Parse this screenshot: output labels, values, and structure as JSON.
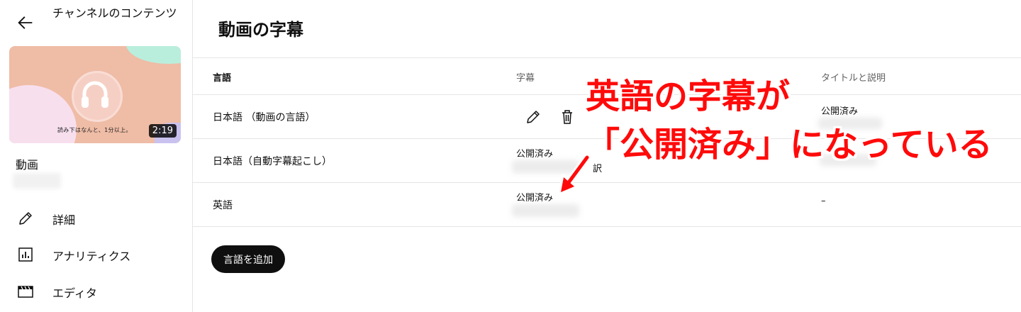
{
  "sidebar": {
    "channel_title": "チャンネルのコンテンツ",
    "thumbnail": {
      "caption": "読み下はなんと、1分以上。",
      "duration": "2:19"
    },
    "video_label": "動画",
    "nav": [
      {
        "label": "詳細",
        "icon": "pencil-icon"
      },
      {
        "label": "アナリティクス",
        "icon": "analytics-icon"
      },
      {
        "label": "エディタ",
        "icon": "clapperboard-icon"
      }
    ]
  },
  "main": {
    "title": "動画の字幕",
    "columns": {
      "language": "言語",
      "subtitles": "字幕",
      "title_desc": "タイトルと説明"
    },
    "rows": [
      {
        "language": "日本語 （動画の言語）",
        "subtitle_status": "",
        "title_status": "公開済み"
      },
      {
        "language": "日本語（自動字幕起こし）",
        "subtitle_status": "公開済み",
        "partial_text": "訳",
        "title_status": ""
      },
      {
        "language": "英語",
        "subtitle_status": "公開済み",
        "title_status": "–"
      }
    ],
    "add_language_label": "言語を追加"
  },
  "annotation": {
    "line1": "英語の字幕が",
    "line2": "「公開済み」になっている",
    "color": "#ff0a0a"
  }
}
